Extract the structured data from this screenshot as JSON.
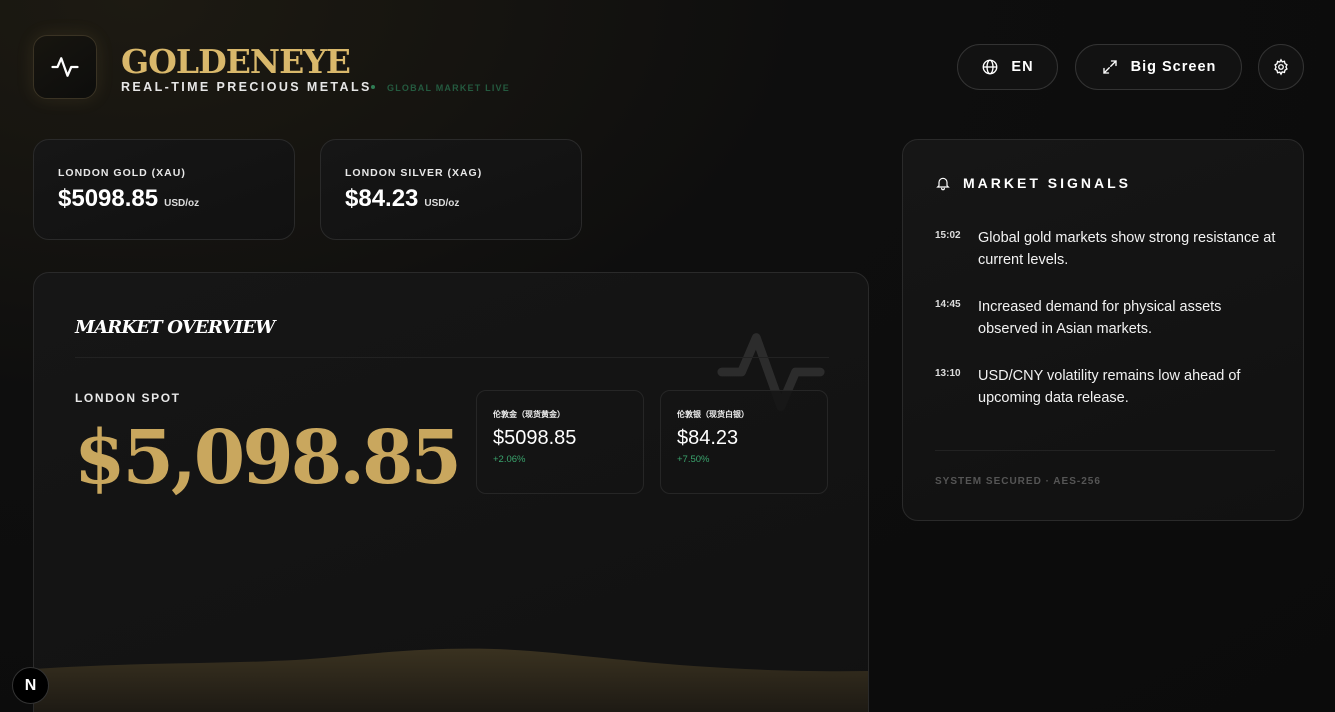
{
  "brand": {
    "title": "GOLDENEYE",
    "subtitle": "REAL-TIME PRECIOUS METALS",
    "live_text": "GLOBAL MARKET LIVE"
  },
  "header": {
    "lang_label": "EN",
    "bigscreen_label": "Big Screen"
  },
  "tickers": [
    {
      "label": "LONDON GOLD (XAU)",
      "price": "$5098.85",
      "unit": "USD/oz"
    },
    {
      "label": "LONDON SILVER (XAG)",
      "price": "$84.23",
      "unit": "USD/oz"
    }
  ],
  "overview": {
    "title": "MARKET OVERVIEW",
    "spot_label": "LONDON SPOT",
    "spot_price": "$5,098.85",
    "mini_cards": [
      {
        "label": "伦敦金（现货黄金）",
        "price": "$5098.85",
        "change": "+2.06%"
      },
      {
        "label": "伦敦银（现货白银）",
        "price": "$84.23",
        "change": "+7.50%"
      }
    ]
  },
  "signals": {
    "title": "MARKET SIGNALS",
    "items": [
      {
        "time": "15:02",
        "text": "Global gold markets show strong resistance at current levels."
      },
      {
        "time": "14:45",
        "text": "Increased demand for physical assets observed in Asian markets."
      },
      {
        "time": "13:10",
        "text": "USD/CNY volatility remains low ahead of upcoming data release."
      }
    ],
    "footer": "SYSTEM SECURED · AES-256"
  },
  "badge": {
    "letter": "N"
  },
  "colors": {
    "gold": "#c9a75e",
    "positive": "#3aa46d",
    "live": "#2f7d54"
  }
}
